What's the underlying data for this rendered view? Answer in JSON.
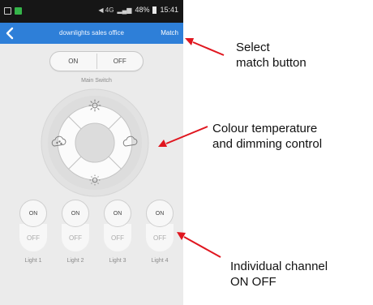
{
  "status_bar": {
    "network": "◀ 4G",
    "battery": "48%",
    "time": "15:41"
  },
  "app_bar": {
    "back_icon": "chevron-left-icon",
    "title": "downlights sales office",
    "match_label": "Match"
  },
  "main_switch": {
    "on_label": "ON",
    "off_label": "OFF",
    "caption": "Main Switch"
  },
  "dpad": {
    "icons": [
      "brightness-up-icon",
      "cool-temperature-icon",
      "warm-temperature-icon",
      "brightness-down-icon"
    ]
  },
  "channels": [
    {
      "on": "ON",
      "off": "OFF",
      "label": "Light 1"
    },
    {
      "on": "ON",
      "off": "OFF",
      "label": "Light 2"
    },
    {
      "on": "ON",
      "off": "OFF",
      "label": "Light 3"
    },
    {
      "on": "ON",
      "off": "OFF",
      "label": "Light 4"
    }
  ],
  "annotations": {
    "match": "Select\nmatch button",
    "dpad": "Colour temperature\nand dimming control",
    "channels": "Individual channel\nON OFF"
  },
  "colors": {
    "app_bar": "#2e7fd8",
    "arrow": "#e0161f"
  }
}
